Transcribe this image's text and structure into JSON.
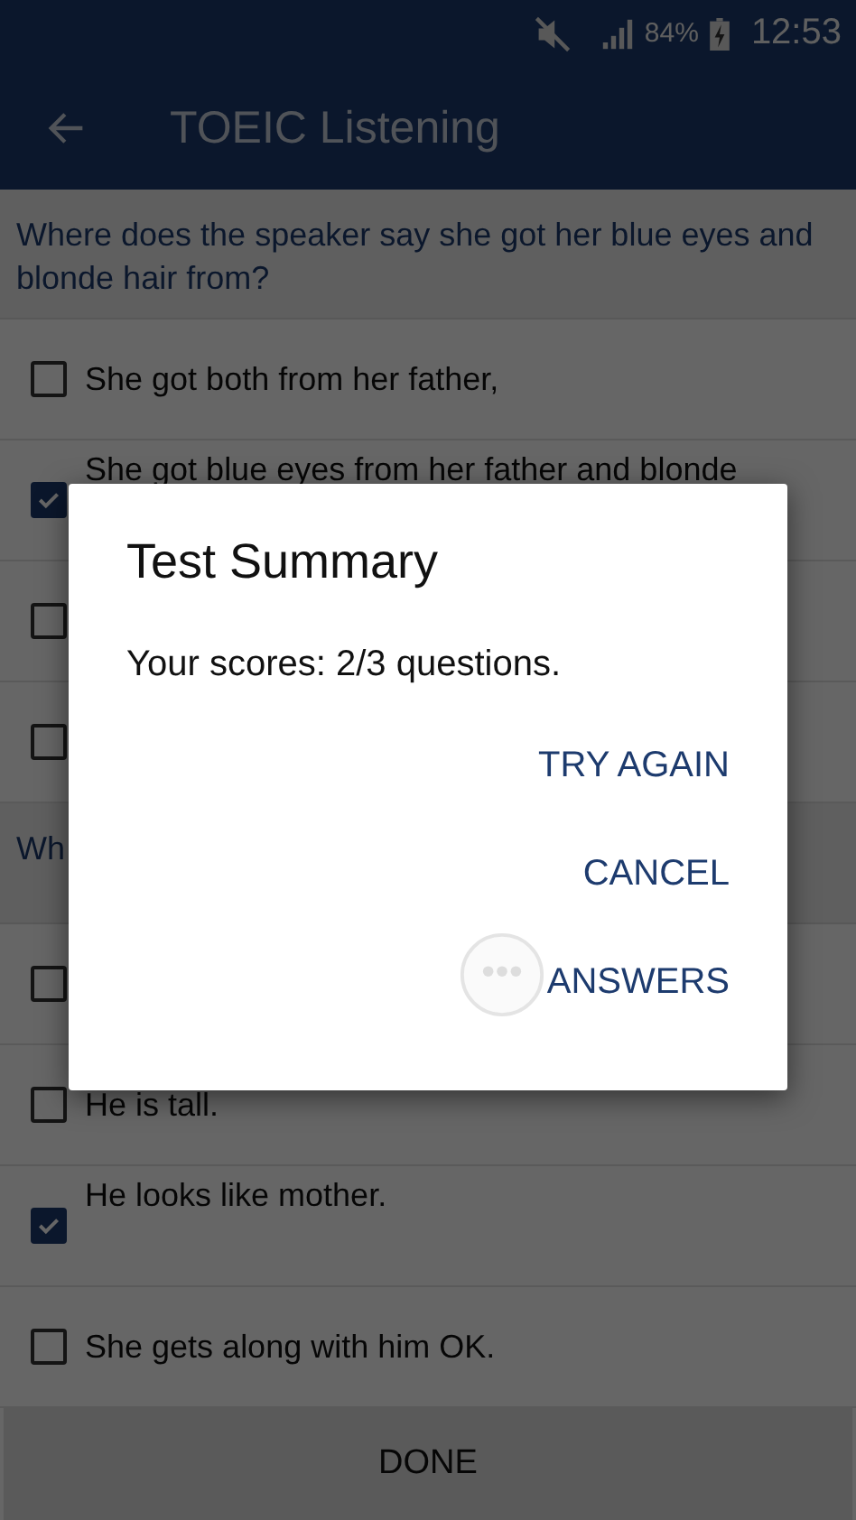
{
  "status_bar": {
    "battery": "84%",
    "time": "12:53"
  },
  "app_bar": {
    "title": "TOEIC Listening"
  },
  "questions": [
    {
      "text": "Where does the speaker say she got her blue eyes and blonde hair from?",
      "options": [
        {
          "text": "She got both from her father,",
          "checked": false
        },
        {
          "text": "She got blue eyes from her father and blonde",
          "checked": true
        },
        {
          "checked": false
        },
        {
          "checked": false
        }
      ]
    },
    {
      "text": "Wh",
      "options": [
        {
          "checked": false
        },
        {
          "text": "He is tall.",
          "checked": false
        },
        {
          "text": "He looks like mother.",
          "checked": true
        },
        {
          "text": "She gets along with him OK.",
          "checked": false
        }
      ]
    }
  ],
  "done_button": "DONE",
  "dialog": {
    "title": "Test Summary",
    "message": "Your scores: 2/3 questions.",
    "buttons": [
      "TRY AGAIN",
      "CANCEL",
      "ANSWERS"
    ]
  }
}
